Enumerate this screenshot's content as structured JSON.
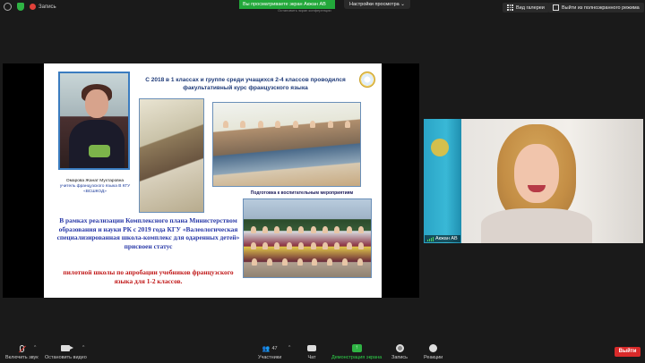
{
  "topbar": {
    "record_label": "Запись",
    "viewing_banner": "Вы просматриваете экран Акжан АВ",
    "view_settings_label": "Настройки просмотра",
    "under_note": "Остановить экран конференции",
    "gallery_label": "Вид галереи",
    "exit_fullscreen_label": "Выйти из полноэкранного режима"
  },
  "slide": {
    "title": "С 2018 в 1 классах  и группе среди учащихся 2-4 классов проводился факультативный курс французского языка",
    "teacher_name": "Омарова Жанат Мухтаровна",
    "teacher_role": "учитель французского языка В КГУ «ВСШКОД»",
    "caption": "Подготовка к воспитательным мероприятиям",
    "paragraph": "В рамках реализации Комплексного плана Министерством образования и науки РК с 2019 года КГУ «Валеологическая специализированная школа-комплекс для одаренных детей» присвоен статус",
    "paragraph_red": "пилотной школы по апробации учебников французского языка для 1-2 классов."
  },
  "video": {
    "participant_name": "Акжан АВ"
  },
  "controls": {
    "mute_label": "Включить звук",
    "video_label": "Остановить видео",
    "participants_label": "Участники",
    "participants_count": "47",
    "chat_label": "Чат",
    "share_label": "Демонстрация экрана",
    "record_label": "Запись",
    "reactions_label": "Реакции",
    "leave_label": "Выйти"
  },
  "icons": [
    "info-icon",
    "shield-icon",
    "record-icon",
    "gallery-icon",
    "fullscreen-icon",
    "mic-muted-icon",
    "camera-icon",
    "participants-icon",
    "chat-icon",
    "share-screen-icon",
    "record-icon",
    "reactions-icon"
  ],
  "colors": {
    "share_green": "#2fb344",
    "leave_red": "#d82a2a",
    "slide_blue": "#2a3aa8",
    "slide_red": "#c01818"
  }
}
